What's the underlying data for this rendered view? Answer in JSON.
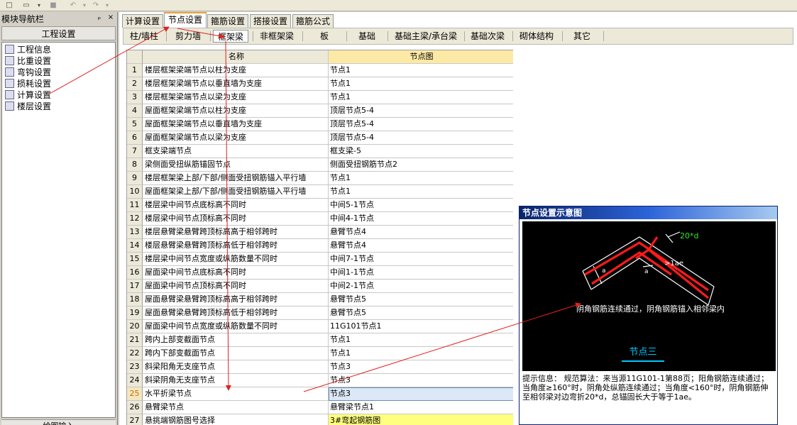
{
  "toolbar": {
    "items": [
      "new-file-icon",
      "open-folder-icon",
      "save-icon",
      "undo-icon",
      "redo-icon"
    ]
  },
  "nav": {
    "title": "模块导航栏",
    "pin": "ₚ",
    "close": "×",
    "header": "工程设置",
    "items": [
      {
        "label": "工程信息",
        "icon": "project-info-icon"
      },
      {
        "label": "比重设置",
        "icon": "weight-icon"
      },
      {
        "label": "弯钩设置",
        "icon": "hook-icon"
      },
      {
        "label": "损耗设置",
        "icon": "loss-icon"
      },
      {
        "label": "计算设置",
        "icon": "calc-icon"
      },
      {
        "label": "楼层设置",
        "icon": "floor-icon"
      }
    ],
    "bottom": "绘图输入"
  },
  "tabs": [
    "计算设置",
    "节点设置",
    "箍筋设置",
    "搭接设置",
    "箍筋公式"
  ],
  "active_tab": 1,
  "subtabs": [
    "柱/墙柱",
    "剪力墙",
    "框架梁",
    "非框架梁",
    "板",
    "基础",
    "基础主梁/承台梁",
    "基础次梁",
    "砌体结构",
    "其它"
  ],
  "active_subtab": 2,
  "grid": {
    "col_name": "名称",
    "col_val": "节点图",
    "rows": [
      {
        "n": "1",
        "name": "楼层框架梁端节点以柱为支座",
        "val": "节点1"
      },
      {
        "n": "2",
        "name": "楼层框架梁端节点以垂直墙为支座",
        "val": "节点1"
      },
      {
        "n": "3",
        "name": "楼层框架梁端节点以梁为支座",
        "val": "节点1"
      },
      {
        "n": "4",
        "name": "屋面框架梁端节点以柱为支座",
        "val": "顶层节点5-4"
      },
      {
        "n": "5",
        "name": "屋面框架梁端节点以垂直墙为支座",
        "val": "顶层节点5-4"
      },
      {
        "n": "6",
        "name": "屋面框架梁端节点以梁为支座",
        "val": "顶层节点5-4"
      },
      {
        "n": "7",
        "name": "框支梁端节点",
        "val": "框支梁-5"
      },
      {
        "n": "8",
        "name": "梁侧面受扭纵筋锚固节点",
        "val": "侧面受扭钢筋节点2"
      },
      {
        "n": "9",
        "name": "楼层框架梁上部/下部/侧面受扭钢筋锚入平行墙",
        "val": "节点1"
      },
      {
        "n": "10",
        "name": "屋面框架梁上部/下部/侧面受扭钢筋锚入平行墙",
        "val": "节点1"
      },
      {
        "n": "11",
        "name": "楼层梁中间节点底标高不同时",
        "val": "中间5-1节点"
      },
      {
        "n": "12",
        "name": "楼层梁中间节点顶标高不同时",
        "val": "中间4-1节点"
      },
      {
        "n": "13",
        "name": "楼层悬臂梁悬臂跨顶标高高于相邻跨时",
        "val": "悬臂节点4"
      },
      {
        "n": "14",
        "name": "楼层悬臂梁悬臂跨顶标高低于相邻跨时",
        "val": "悬臂节点4"
      },
      {
        "n": "15",
        "name": "楼层梁中间节点宽度或纵筋数量不同时",
        "val": "中间7-1节点"
      },
      {
        "n": "16",
        "name": "屋面梁中间节点底标高不同时",
        "val": "中间1-1节点"
      },
      {
        "n": "17",
        "name": "屋面梁中间节点顶标高不同时",
        "val": "中间2-1节点"
      },
      {
        "n": "18",
        "name": "屋面悬臂梁悬臂跨顶标高高于相邻跨时",
        "val": "悬臂节点5"
      },
      {
        "n": "19",
        "name": "屋面悬臂梁悬臂跨顶标高低于相邻跨时",
        "val": "悬臂节点5"
      },
      {
        "n": "20",
        "name": "屋面梁中间节点宽度或纵筋数量不同时",
        "val": "11G101节点1"
      },
      {
        "n": "21",
        "name": "跨内上部变截面节点",
        "val": "节点1"
      },
      {
        "n": "22",
        "name": "跨内下部变截面节点",
        "val": "节点1"
      },
      {
        "n": "23",
        "name": "斜梁阳角无支座节点",
        "val": "节点3"
      },
      {
        "n": "24",
        "name": "斜梁阴角无支座节点",
        "val": "节点3"
      },
      {
        "n": "25",
        "name": "水平折梁节点",
        "val": "节点3"
      },
      {
        "n": "26",
        "name": "悬臂梁节点",
        "val": "悬臂梁节点1"
      },
      {
        "n": "27",
        "name": "悬挑端钢筋图号选择",
        "val": "3#弯起钢筋图"
      }
    ],
    "selected_row": 24,
    "highlight_row": 26
  },
  "dialog": {
    "title": "节点设置示意图",
    "label_20d": "20*d",
    "label_lae": ">1ae",
    "label_a": "a",
    "label_a2": "a",
    "desc": "阴角钢筋连续通过，阴角钢筋锚入相邻梁内",
    "node_name": "节点三",
    "info_label": "提示信息：",
    "info_text": "规范算法：来当源11G101-1第88页；阳角钢筋连续通过；当角度≥160°时，阴角处纵筋连续通过；当角度<160°时，阴角钢筋伸至相邻梁对边弯折20*d，总锚固长大于等于1ae。"
  },
  "colors": {
    "annotation": "#e02020",
    "rebar": "#ff1a1a",
    "accent": "#00c8ff",
    "green": "#2ee82e"
  }
}
